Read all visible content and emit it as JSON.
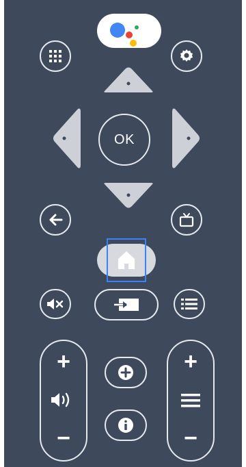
{
  "colors": {
    "background": "#3e4a5c",
    "outline": "#e6e9ee",
    "dpad": "#cdd1d7",
    "selection": "#3b82f6",
    "assistant_blue": "#4285f4",
    "assistant_red": "#ea4335",
    "assistant_yellow": "#fbbc05",
    "assistant_green": "#34a853"
  },
  "remote": {
    "assistant": {
      "icon": "google-assistant-icon"
    },
    "apps": {
      "icon": "apps-grid-icon"
    },
    "settings": {
      "icon": "gear-icon"
    },
    "dpad": {
      "up_icon": "dpad-up",
      "down_icon": "dpad-down",
      "left_icon": "dpad-left",
      "right_icon": "dpad-right",
      "ok_label": "OK"
    },
    "back": {
      "icon": "arrow-left-icon"
    },
    "tv": {
      "icon": "tv-icon"
    },
    "home": {
      "icon": "home-icon",
      "selected": true
    },
    "mute": {
      "icon": "mute-icon"
    },
    "input": {
      "icon": "input-source-icon"
    },
    "guide": {
      "icon": "guide-list-icon"
    },
    "volume": {
      "plus": "+",
      "minus": "−",
      "icon": "volume-icon"
    },
    "add": {
      "icon": "plus-circle-icon"
    },
    "info": {
      "icon": "info-icon"
    },
    "channel": {
      "plus": "+",
      "minus": "−",
      "icon": "channel-list-icon"
    }
  }
}
